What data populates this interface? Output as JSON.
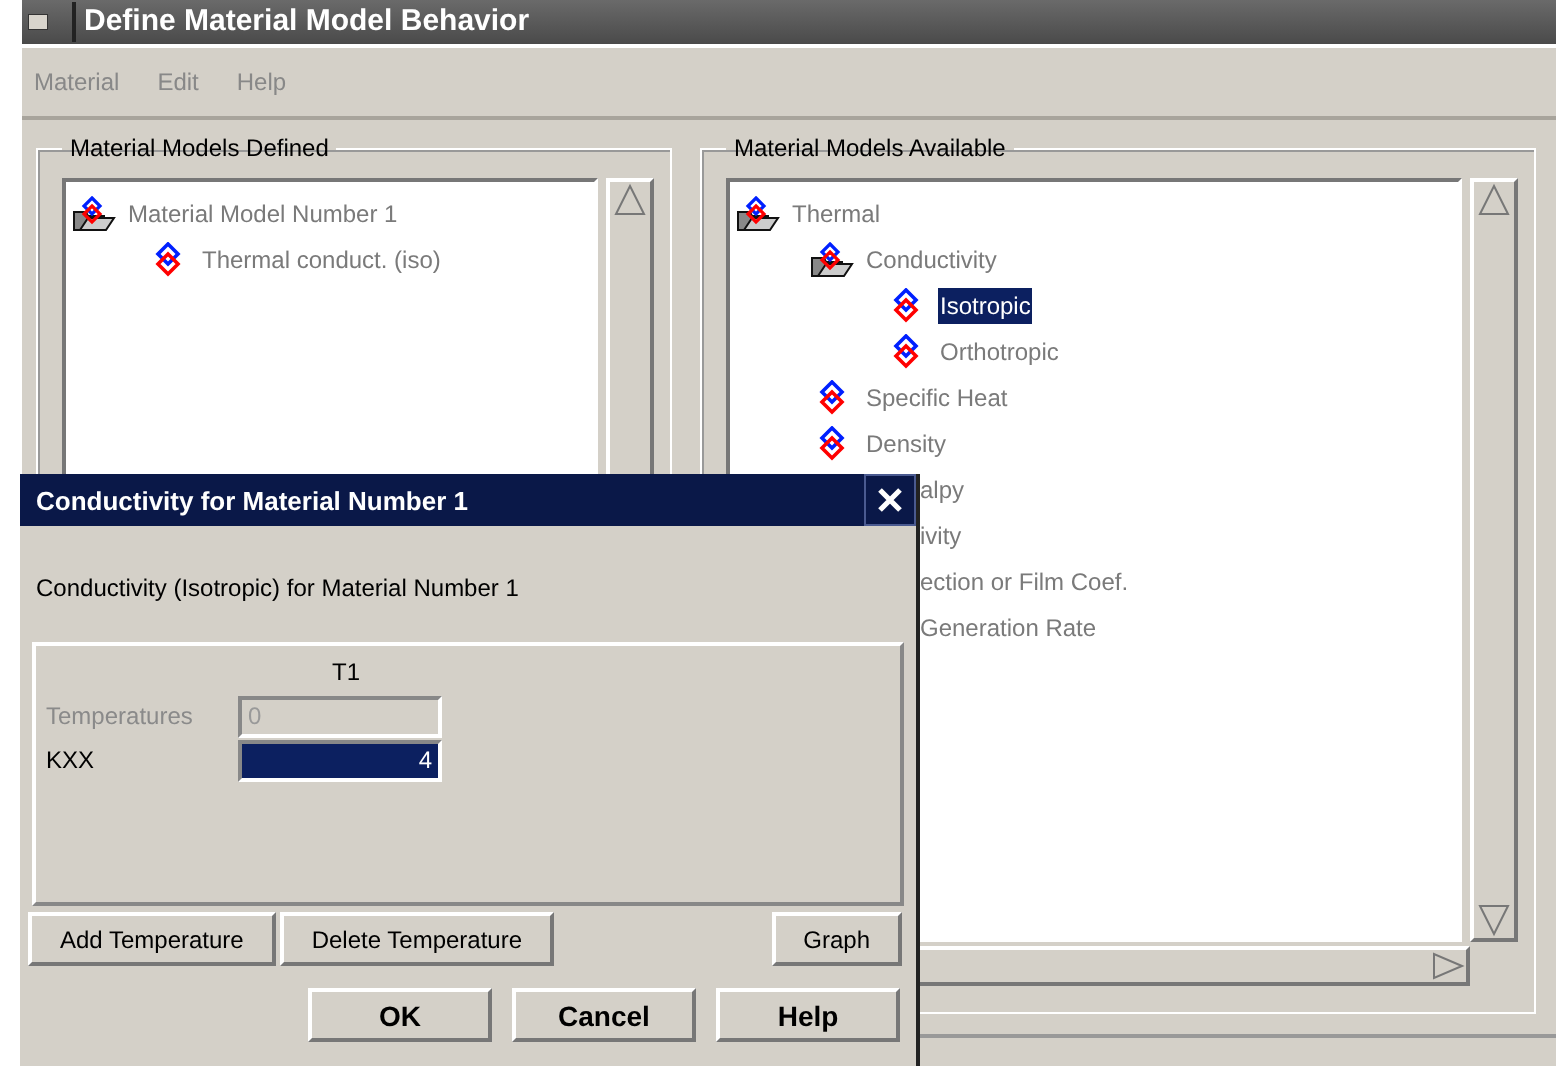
{
  "window": {
    "title": "Define Material Model Behavior"
  },
  "menu": [
    "Material",
    "Edit",
    "Help"
  ],
  "defined": {
    "title": "Material Models Defined",
    "tree": [
      {
        "label": "Material Model Number 1",
        "selected": false,
        "children": [
          {
            "label": "Thermal conduct. (iso)",
            "selected": false
          }
        ]
      }
    ]
  },
  "available": {
    "title": "Material Models Available",
    "tree": [
      {
        "label": "Thermal",
        "selected": false,
        "children": [
          {
            "label": "Conductivity",
            "selected": false,
            "children": [
              {
                "label": "Isotropic",
                "selected": true
              },
              {
                "label": "Orthotropic",
                "selected": false
              }
            ]
          },
          {
            "label": "Specific Heat",
            "selected": false
          },
          {
            "label": "Density",
            "selected": false
          },
          {
            "label": "alpy",
            "selected": false,
            "cut": true
          },
          {
            "label": "ivity",
            "selected": false,
            "cut": true
          },
          {
            "label": "ection or Film Coef.",
            "selected": false,
            "cut": true
          },
          {
            "label": "Generation Rate",
            "selected": false,
            "cut": true
          }
        ]
      }
    ]
  },
  "dialog": {
    "title": "Conductivity for Material Number 1",
    "heading": "Conductivity (Isotropic) for Material Number 1",
    "column": "T1",
    "rows": [
      {
        "label": "Temperatures",
        "value": "0",
        "disabled": true,
        "selected": false
      },
      {
        "label": "KXX",
        "value": "4",
        "disabled": false,
        "selected": true
      }
    ],
    "table_buttons": [
      "Add Temperature",
      "Delete Temperature",
      "Graph"
    ],
    "buttons": [
      "OK",
      "Cancel",
      "Help"
    ]
  }
}
